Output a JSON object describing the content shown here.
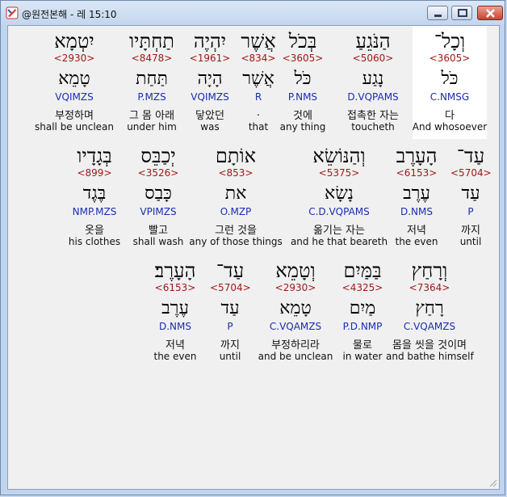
{
  "window": {
    "title": "@원전본해 - 레 15:10",
    "min_glyph": "minimize",
    "max_glyph": "maximize",
    "close_glyph": "close"
  },
  "rows": [
    {
      "words": [
        {
          "hebrew": "וְכָל־",
          "strong": "<3605>",
          "lemma": "כֹּל",
          "morph": "C.NMSG",
          "korean": "다",
          "english": "And whosoever",
          "selected": true
        },
        {
          "hebrew": "הַנֹּגֵעַ",
          "strong": "<5060>",
          "lemma": "נָגַע",
          "morph": "D.VQPAMS",
          "korean": "접촉한 자는",
          "english": "toucheth"
        },
        {
          "hebrew": "בְּכֹל",
          "strong": "<3605>",
          "lemma": "כֹּל",
          "morph": "P.NMS",
          "korean": "것에",
          "english": "any thing"
        },
        {
          "hebrew": "אֲשֶׁר",
          "strong": "<834>",
          "lemma": "אֲשֶׁר",
          "morph": "R",
          "korean": ".",
          "english": "that"
        },
        {
          "hebrew": "יִהְיֶה",
          "strong": "<1961>",
          "lemma": "הָיָה",
          "morph": "VQIMZS",
          "korean": "닿았던",
          "english": "was"
        },
        {
          "hebrew": "תַחְתָּיו",
          "strong": "<8478>",
          "lemma": "תַּחַת",
          "morph": "P.MZS",
          "korean": "그 몸 아래",
          "english": "under him"
        },
        {
          "hebrew": "יִטְמָא",
          "strong": "<2930>",
          "lemma": "טָמֵא",
          "morph": "VQIMZS",
          "korean": "부정하며",
          "english": "shall be unclean"
        }
      ]
    },
    {
      "words": [
        {
          "hebrew": "עַד־",
          "strong": "<5704>",
          "lemma": "עַד",
          "morph": "P",
          "korean": "까지",
          "english": "until"
        },
        {
          "hebrew": "הָעָרֶב",
          "strong": "<6153>",
          "lemma": "עֶרֶב",
          "morph": "D.NMS",
          "korean": "저녁",
          "english": "the even"
        },
        {
          "hebrew": "וְהַנּוֹשֵׂא",
          "strong": "<5375>",
          "lemma": "נָשָׂא",
          "morph": "C.D.VQPAMS",
          "korean": "옮기는 자는",
          "english": "and he that beareth"
        },
        {
          "hebrew": "אוֹתָם",
          "strong": "<853>",
          "lemma": "את",
          "morph": "O.MZP",
          "korean": "그런 것을",
          "english": "any of those things"
        },
        {
          "hebrew": "יְכַבֵּס",
          "strong": "<3526>",
          "lemma": "כָּבַס",
          "morph": "VPIMZS",
          "korean": "빨고",
          "english": "shall wash"
        },
        {
          "hebrew": "בְּגָדָיו",
          "strong": "<899>",
          "lemma": "בֶּגֶד",
          "morph": "NMP.MZS",
          "korean": "옷을",
          "english": "his clothes"
        }
      ]
    },
    {
      "words": [
        {
          "hebrew": "וְרָחַץ",
          "strong": "<7364>",
          "lemma": "רָחַץ",
          "morph": "C.VQAMZS",
          "korean": "몸을 씻을 것이며",
          "english": "and bathe himself"
        },
        {
          "hebrew": "בַּמַּיִם",
          "strong": "<4325>",
          "lemma": "מַיִם",
          "morph": "P.D.NMP",
          "korean": "물로",
          "english": "in water"
        },
        {
          "hebrew": "וְטָמֵא",
          "strong": "<2930>",
          "lemma": "טָמֵא",
          "morph": "C.VQAMZS",
          "korean": "부정하리라",
          "english": "and be unclean"
        },
        {
          "hebrew": "עַד־",
          "strong": "<5704>",
          "lemma": "עַד",
          "morph": "P",
          "korean": "까지",
          "english": "until"
        },
        {
          "hebrew": "הָעָרֶב׃",
          "strong": "<6153>",
          "lemma": "עֶרֶב",
          "morph": "D.NMS",
          "korean": "저녁",
          "english": "the even"
        }
      ]
    }
  ]
}
